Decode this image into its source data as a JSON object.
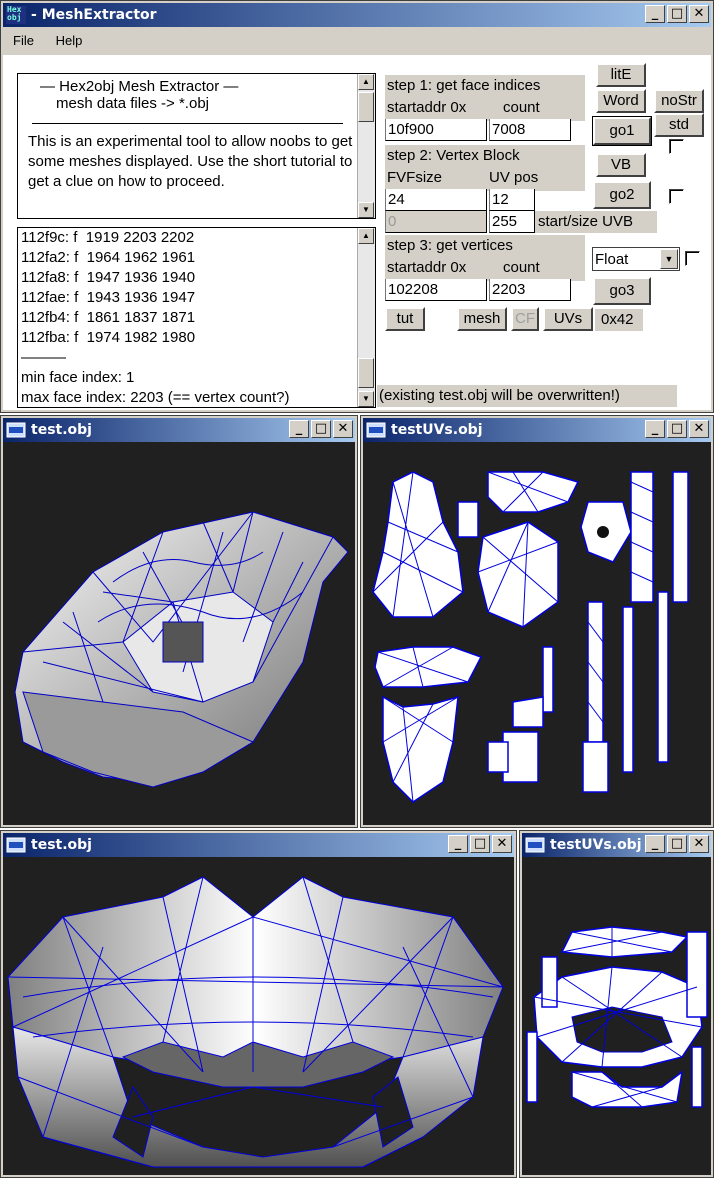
{
  "main": {
    "title": "MeshExtractor",
    "menu": [
      "File",
      "Help"
    ],
    "info_lines": [
      "—  Hex2obj Mesh Extractor  —",
      "mesh data files -> *.obj"
    ],
    "info_body": "This is an experimental tool to allow noobs to get some meshes displayed. Use the short tutorial to get a clue on how to proceed.",
    "log_lines": [
      "112f9c: f  1919 2203 2202",
      "112fa2: f  1964 1962 1961",
      "112fa8: f  1947 1936 1940",
      "112fae: f  1943 1936 1947",
      "112fb4: f  1861 1837 1871",
      "112fba: f  1974 1982 1980"
    ],
    "log_sep": "———",
    "log_min": "min face index: 1",
    "log_max": "max face index: 2203 (== vertex count?)",
    "step1": {
      "title": "step 1: get face indices",
      "addr_label": "startaddr 0x",
      "count_label": "count",
      "addr": "10f900",
      "count": "7008"
    },
    "step2": {
      "title": "step 2: Vertex Block",
      "fvf_label": "FVFsize",
      "uv_label": "UV pos",
      "fvf": "24",
      "uv": "12",
      "uvb_start": "0",
      "uvb_size": "255",
      "uvb_label": "start/size UVB"
    },
    "step3": {
      "title": "step 3: get vertices",
      "addr_label": "startaddr 0x",
      "count_label": "count",
      "addr": "102208",
      "count": "2203"
    },
    "buttons": {
      "lite": "litE",
      "word": "Word",
      "nostr": "noStr",
      "std": "std",
      "go1": "go1",
      "vb": "VB",
      "go2": "go2",
      "go3": "go3",
      "tut": "tut",
      "mesh": "mesh",
      "cf": "CF",
      "uvs": "UVs"
    },
    "float_select": "Float",
    "hex_value": "0x42",
    "warning": "(existing test.obj will be overwritten!)"
  },
  "windows": [
    {
      "title": "test.obj"
    },
    {
      "title": "testUVs.obj"
    },
    {
      "title": "test.obj"
    },
    {
      "title": "testUVs.obj"
    }
  ],
  "icons": {
    "app": "hex-obj-app-icon",
    "child": "window-icon"
  }
}
